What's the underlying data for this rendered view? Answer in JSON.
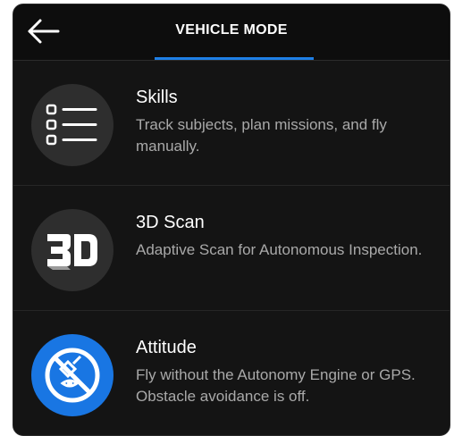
{
  "header": {
    "title": "VEHICLE MODE",
    "back_icon": "arrow-left-icon",
    "accent_color": "#1e7fe6"
  },
  "modes": [
    {
      "title": "Skills",
      "description": "Track subjects, plan missions, and fly manually.",
      "icon": "list-icon"
    },
    {
      "title": "3D Scan",
      "description": "Adaptive Scan for Autonomous Inspection.",
      "icon": "3d-scan-icon"
    },
    {
      "title": "Attitude",
      "description": "Fly without the Autonomy Engine or GPS. Obstacle avoidance is off.",
      "icon": "no-autonomy-icon"
    }
  ]
}
